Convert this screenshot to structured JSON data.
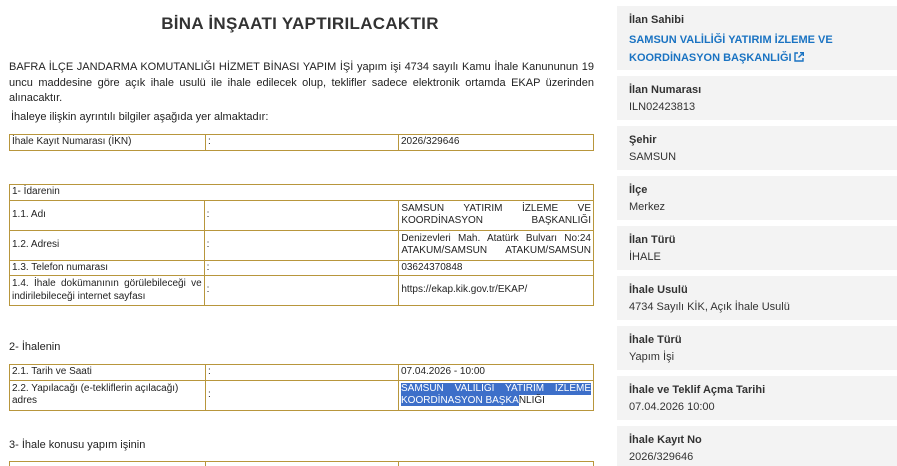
{
  "document": {
    "title": "BİNA İNŞAATI YAPTIRILACAKTIR",
    "intro": "BAFRA İLÇE JANDARMA KOMUTANLIĞI HİZMET BİNASI YAPIM İŞİ yapım işi 4734 sayılı Kamu İhale Kanununun 19 uncu maddesine göre açık ihale usulü ile ihale edilecek olup, teklifler sadece elektronik ortamda EKAP üzerinden alınacaktır.",
    "intro2": "İhaleye ilişkin ayrıntılı bilgiler aşağıda yer almaktadır:",
    "ikn": {
      "label": "İhale Kayıt Numarası (İKN)",
      "sep": ":",
      "value": "2026/329646"
    },
    "idare": {
      "heading": "1- İdarenin",
      "rows": [
        {
          "label": "1.1. Adı",
          "sep": ":",
          "value": "SAMSUN YATIRIM İZLEME VE KOORDİNASYON BAŞKANLIĞI"
        },
        {
          "label": "1.2. Adresi",
          "sep": ":",
          "value": "Denizevleri Mah. Atatürk Bulvarı No:24 ATAKUM/SAMSUN ATAKUM/SAMSUN"
        },
        {
          "label": "1.3. Telefon numarası",
          "sep": ":",
          "value": "03624370848"
        },
        {
          "label": "1.4. İhale dokümanının görülebileceği ve indirilebileceği internet sayfası",
          "sep": ":",
          "value": "https://ekap.kik.gov.tr/EKAP/"
        }
      ]
    },
    "ihale_heading": "2- İhalenin",
    "ihale_rows": [
      {
        "label": "2.1. Tarih ve Saati",
        "sep": ":",
        "value": "07.04.2026 - 10:00"
      },
      {
        "label": "2.2. Yapılacağı (e-tekliflerin açılacağı) adres",
        "sep": ":",
        "value_selected_1": "SAMSUN VALİLİĞİ YATIRIM İZLEME",
        "value_selected_2": "KOORDİNASYON BAŞKA",
        "value_rest": "NLIĞI"
      }
    ],
    "konu_heading": "3- İhale konusu yapım işinin"
  },
  "sidebar": {
    "owner_label": "İlan Sahibi",
    "owner_value": "SAMSUN VALİLİĞİ YATIRIM İZLEME VE KOORDİNASYON BAŞKANLIĞI",
    "items": [
      {
        "label": "İlan Numarası",
        "value": "ILN02423813"
      },
      {
        "label": "Şehir",
        "value": "SAMSUN"
      },
      {
        "label": "İlçe",
        "value": "Merkez"
      },
      {
        "label": "İlan Türü",
        "value": "İHALE"
      },
      {
        "label": "İhale Usulü",
        "value": "4734 Sayılı KİK, Açık İhale Usulü"
      },
      {
        "label": "İhale Türü",
        "value": "Yapım İşi"
      },
      {
        "label": "İhale ve Teklif Açma Tarihi",
        "value": "07.04.2026 10:00"
      },
      {
        "label": "İhale Kayıt No",
        "value": "2026/329646"
      }
    ]
  },
  "colors": {
    "link": "#1a73c2",
    "table_border": "#b8963c",
    "selection": "#3d6fc9",
    "card_bg": "#f3f3f3"
  },
  "icons": {
    "owner_link": "external-link-icon"
  }
}
